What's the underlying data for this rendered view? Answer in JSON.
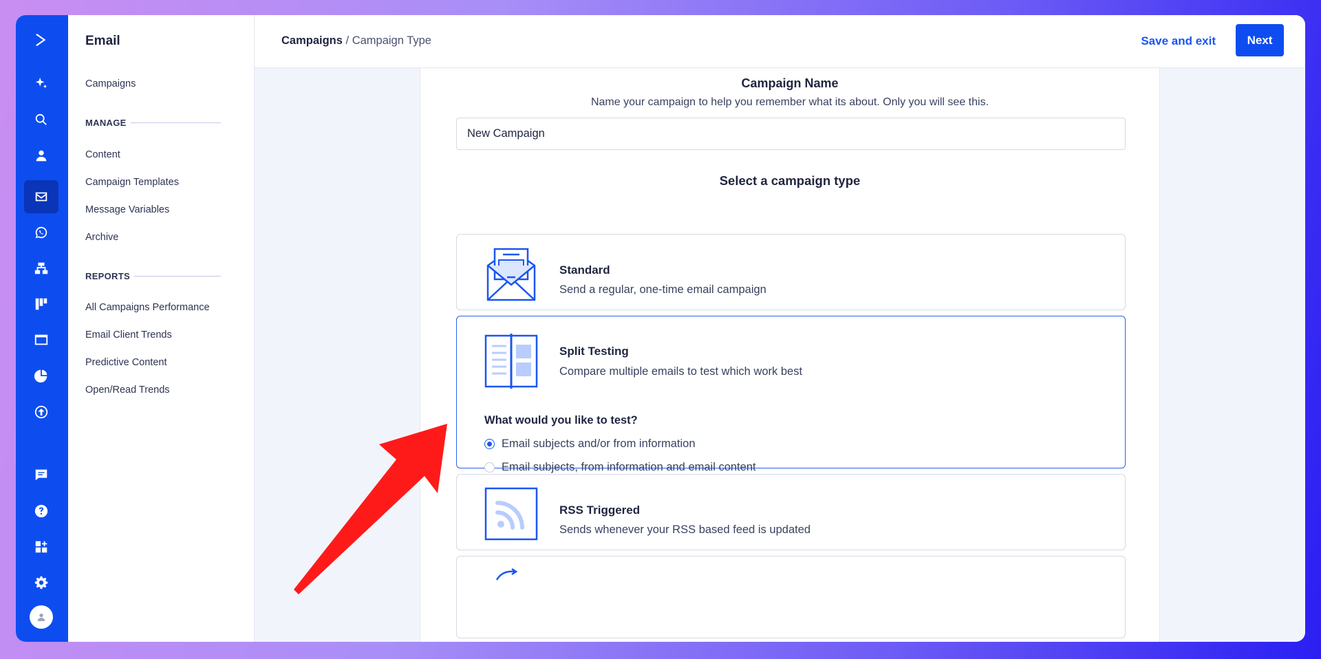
{
  "sidebar": {
    "title": "Email",
    "campaigns_link": "Campaigns",
    "manage_section": "MANAGE",
    "manage_items": [
      "Content",
      "Campaign Templates",
      "Message Variables",
      "Archive"
    ],
    "reports_section": "REPORTS",
    "reports_items": [
      "All Campaigns Performance",
      "Email Client Trends",
      "Predictive Content",
      "Open/Read Trends"
    ]
  },
  "rail": {
    "icons": [
      "logo-icon",
      "sparkle-icon",
      "search-icon",
      "contacts-icon",
      "email-icon",
      "whatsapp-icon",
      "automations-icon",
      "pipelines-icon",
      "website-icon",
      "reports-icon",
      "upload-icon",
      "conversations-icon",
      "help-icon",
      "apps-icon",
      "settings-icon",
      "avatar-icon"
    ],
    "active": "email-icon"
  },
  "header": {
    "breadcrumb_root": "Campaigns",
    "breadcrumb_sep": " / ",
    "breadcrumb_current": "Campaign Type",
    "save_exit_label": "Save and exit",
    "next_label": "Next"
  },
  "campaign_name": {
    "title": "Campaign Name",
    "help": "Name your campaign to help you remember what its about. Only you will see this.",
    "value": "New Campaign"
  },
  "campaign_type": {
    "title": "Select a campaign type",
    "options": [
      {
        "title": "Standard",
        "description": "Send a regular, one-time email campaign",
        "icon": "envelope-icon"
      },
      {
        "title": "Split Testing",
        "description": "Compare multiple emails to test which work best",
        "icon": "split-test-icon",
        "selected": true
      },
      {
        "title": "RSS Triggered",
        "description": "Sends whenever your RSS based feed is updated",
        "icon": "rss-icon"
      }
    ],
    "split_question": "What would you like to test?",
    "split_choices": [
      {
        "label": "Email subjects and/or from information",
        "checked": true
      },
      {
        "label": "Email subjects, from information and email content",
        "checked": false
      }
    ]
  },
  "colors": {
    "brand_blue": "#0d4df0",
    "annotation_arrow": "#ff1a1a"
  }
}
